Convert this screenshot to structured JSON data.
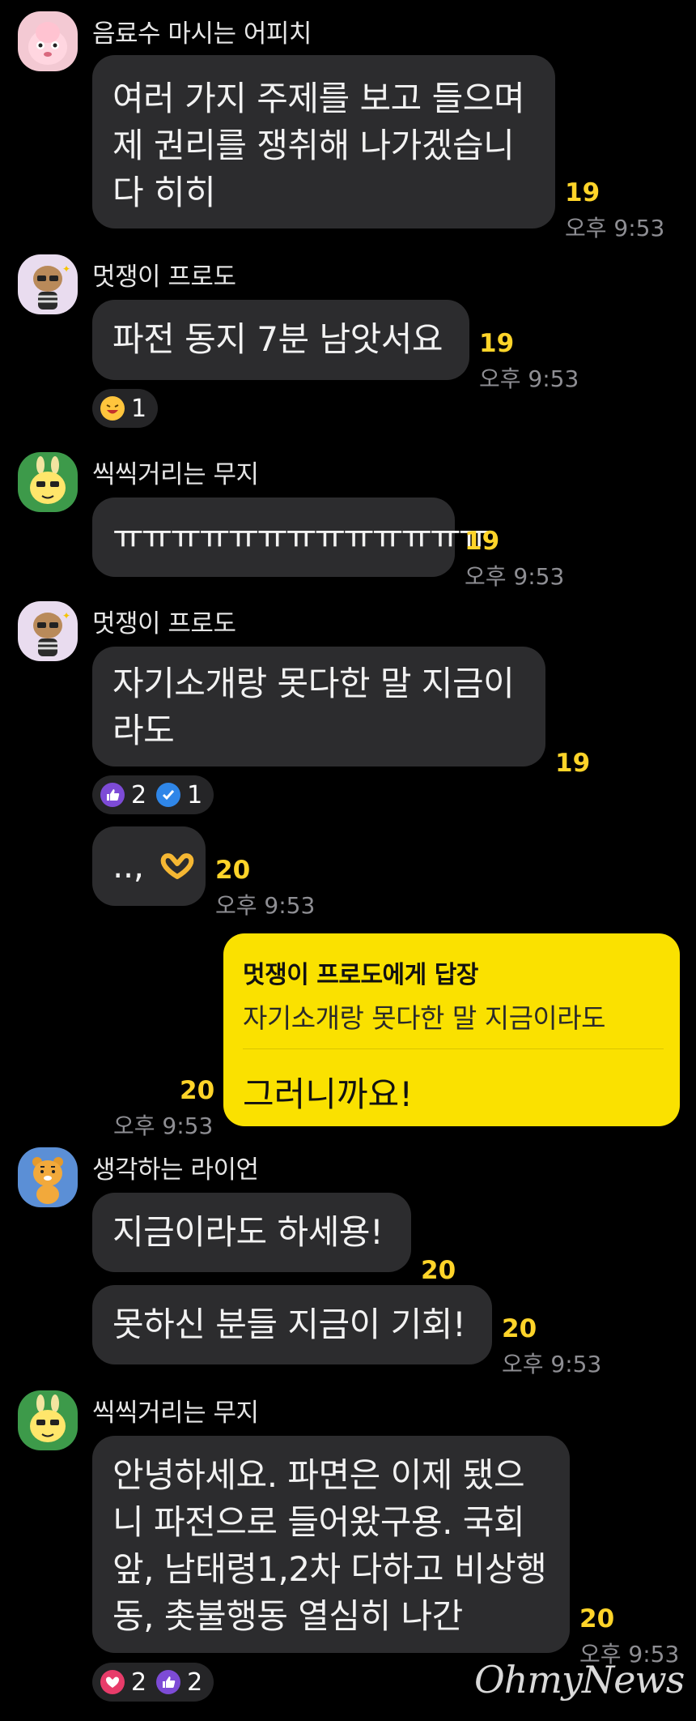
{
  "messages": {
    "m1": {
      "sender": "음료수 마시는 어피치",
      "lines": [
        "여러 가지 주제를 보고 들으며",
        "제 권리를 쟁취해 나가겠습니",
        "다 히히"
      ],
      "unread": "19",
      "time": "오후 9:53"
    },
    "m2": {
      "sender": "멋쟁이 프로도",
      "lines": [
        "파전 동지 7분 남앗서요"
      ],
      "unread": "19",
      "time": "오후 9:53",
      "reaction_count": "1"
    },
    "m3": {
      "sender": "씩씩거리는 무지",
      "lines": [
        "ㅠㅠㅠㅠㅠㅠㅠㅠㅠㅠㅠㅠㅠ"
      ],
      "unread": "19",
      "time": "오후 9:53"
    },
    "m4": {
      "sender": "멋쟁이 프로도",
      "lines": [
        "자기소개랑 못다한 말 지금이",
        "라도"
      ],
      "unread": "19",
      "reaction_like_count": "2",
      "reaction_check_count": "1"
    },
    "m5": {
      "text": "..,",
      "unread": "20",
      "time": "오후 9:53"
    },
    "mine": {
      "reply_to": "멋쟁이 프로도에게 답장",
      "quoted": "자기소개랑 못다한 말 지금이라도",
      "text": "그러니까요!",
      "unread": "20",
      "time": "오후 9:53"
    },
    "m6": {
      "sender": "생각하는 라이언",
      "lines": [
        "지금이라도 하세용!"
      ],
      "unread": "20"
    },
    "m7": {
      "lines": [
        "못하신 분들 지금이 기회!"
      ],
      "unread": "20",
      "time": "오후 9:53"
    },
    "m8": {
      "sender": "씩씩거리는 무지",
      "lines": [
        "안녕하세요. 파면은 이제 됐으",
        "니 파전으로 들어왔구용. 국회",
        "앞, 남태령1,2차 다하고 비상행",
        "동, 촛불행동 열심히 나간"
      ],
      "unread": "20",
      "time": "오후 9:53",
      "reaction_heart_count": "2",
      "reaction_like_count": "2"
    }
  },
  "watermark": "OhmyNews",
  "colors": {
    "background": "#000000",
    "bubble": "#2c2c2e",
    "mine_bubble": "#fae100",
    "unread": "#ffd429",
    "time": "#8e8e93"
  },
  "icons": [
    "apeach-avatar",
    "frodo-avatar",
    "muzi-avatar",
    "ryan-avatar",
    "laughing-emoji-icon",
    "thumbs-up-icon",
    "check-icon",
    "heart-hands-emoji-icon",
    "heart-icon"
  ]
}
